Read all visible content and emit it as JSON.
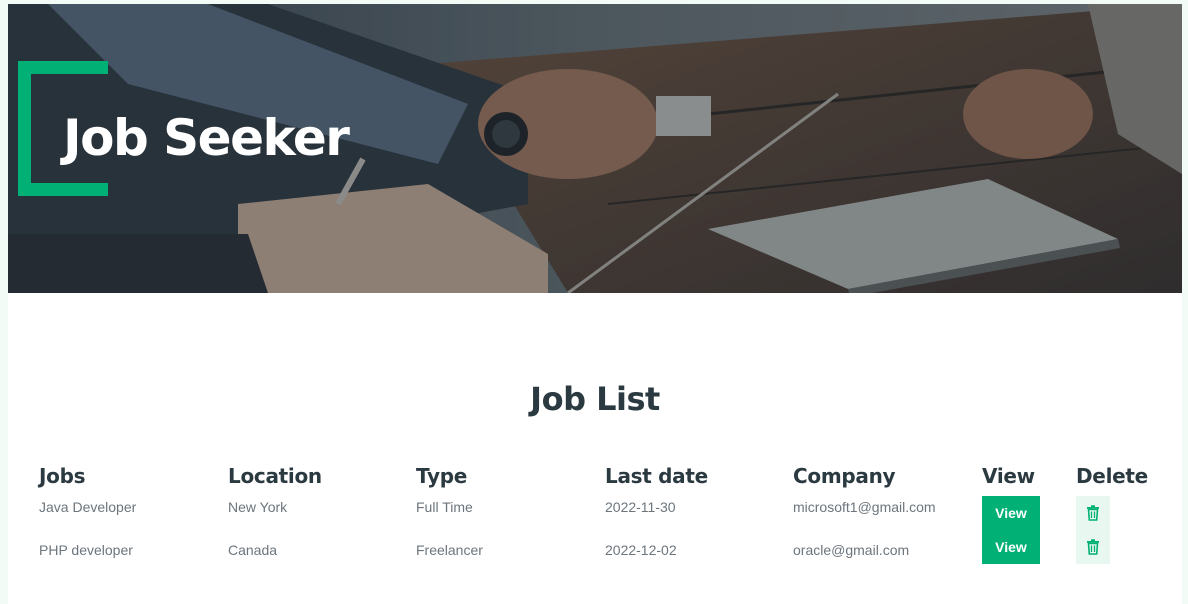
{
  "hero": {
    "title": "Job Seeker"
  },
  "section": {
    "title": "Job List"
  },
  "columns": [
    "Jobs",
    "Location",
    "Type",
    "Last date",
    "Company",
    "View",
    "Delete"
  ],
  "rows": [
    {
      "job": "Java Developer",
      "location": "New York",
      "type": "Full Time",
      "last_date": "2022-11-30",
      "company": "microsoft1@gmail.com",
      "view_label": "View",
      "delete_icon": "trash-icon"
    },
    {
      "job": "PHP developer",
      "location": "Canada",
      "type": "Freelancer",
      "last_date": "2022-12-02",
      "company": "oracle@gmail.com",
      "view_label": "View",
      "delete_icon": "trash-icon"
    }
  ],
  "colors": {
    "accent": "#00b074",
    "heading": "#2b3940",
    "text_muted": "#6c757d",
    "delete_bg": "#e8f7f0"
  }
}
